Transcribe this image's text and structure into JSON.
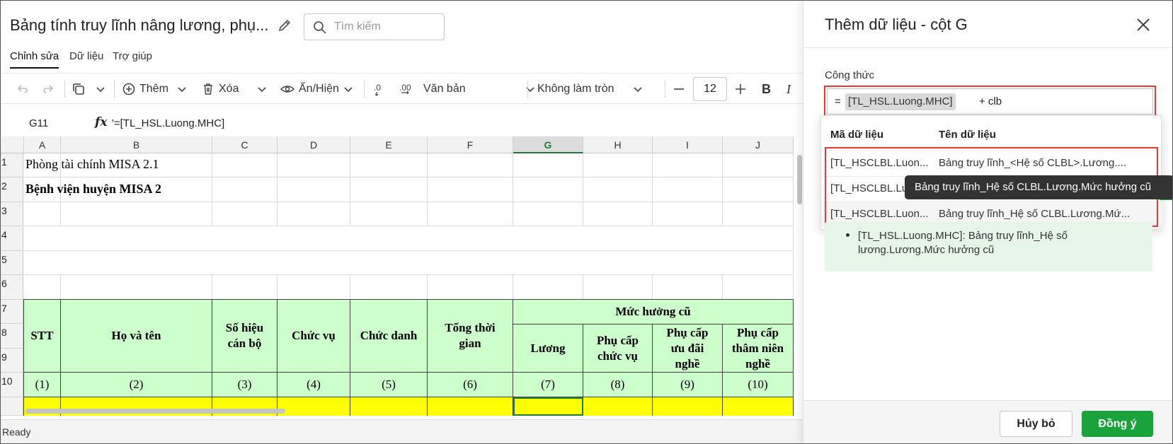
{
  "document": {
    "title": "Bảng tính truy lĩnh nâng lương, phụ..."
  },
  "search": {
    "placeholder": "Tìm kiếm"
  },
  "menu_tabs": [
    "Chỉnh sửa",
    "Dữ liệu",
    "Trợ giúp"
  ],
  "toolbar": {
    "insert_label": "Thêm",
    "delete_label": "Xóa",
    "show_hide_label": "Ẩn/Hiện",
    "format_label": "Văn bản",
    "rounding_label": "Không làm tròn",
    "font_size": "12",
    "bold_label": "B",
    "italic_label": "I"
  },
  "formula_bar": {
    "cell_ref": "G11",
    "fx": "fx",
    "value": "'=[TL_HSL.Luong.MHC]"
  },
  "grid": {
    "columns": [
      "A",
      "B",
      "C",
      "D",
      "E",
      "F",
      "G",
      "H",
      "I",
      "J"
    ],
    "selected_column": "G",
    "rows": [
      "1",
      "2",
      "3",
      "4",
      "5",
      "6",
      "7",
      "8",
      "9",
      "10"
    ],
    "a1": "Phòng tài chính MISA 2.1",
    "a2": "Bệnh viện huyện MISA 2",
    "headers": {
      "stt": "STT",
      "ho_ten": "Họ và tên",
      "so_hieu": "Số hiệu cán bộ",
      "chuc_vu": "Chức vụ",
      "chuc_danh": "Chức danh",
      "tong_thoi_gian": "Tổng thời gian",
      "muc_huong_cu": "Mức hưởng cũ",
      "luong": "Lương",
      "phu_cap_chuc_vu": "Phụ cấp chức vụ",
      "phu_cap_uu_dai": "Phụ cấp ưu đãi nghề",
      "phu_cap_tham_nien": "Phụ cấp thâm niên nghề"
    },
    "numbers": [
      "(1)",
      "(2)",
      "(3)",
      "(4)",
      "(5)",
      "(6)",
      "(7)",
      "(8)",
      "(9)",
      "(10)"
    ]
  },
  "status": {
    "text": "Ready"
  },
  "panel": {
    "title": "Thêm dữ liệu - cột G",
    "formula_label": "Công thức",
    "formula_eq": "=",
    "formula_token": "[TL_HSL.Luong.MHC]",
    "formula_rest": "+ clb",
    "dropdown": {
      "col_code": "Mã dữ liệu",
      "col_name": "Tên dữ liệu",
      "rows": [
        {
          "code": "[TL_HSCLBL.Luon...",
          "name": "Bảng truy lĩnh_<Hệ số CLBL>.Lương...."
        },
        {
          "code": "[TL_HSCLBL.Luo",
          "name": ""
        },
        {
          "code": "[TL_HSCLBL.Luon...",
          "name": "Bảng truy lĩnh_Hệ số CLBL.Lương.Mứ..."
        }
      ]
    },
    "tooltip": "Bảng truy lĩnh_Hệ số CLBL.Lương.Mức hưởng cũ",
    "info": "[TL_HSL.Luong.MHC]: Bảng truy lĩnh_Hệ số lương.Lương.Mức hưởng cũ",
    "cancel_label": "Hủy bỏ",
    "ok_label": "Đồng ý"
  },
  "colors": {
    "accent_green": "#1aa33b",
    "header_fill": "#ccffcc",
    "highlight_yellow": "#ffff00",
    "annotation_red": "#e53935"
  }
}
